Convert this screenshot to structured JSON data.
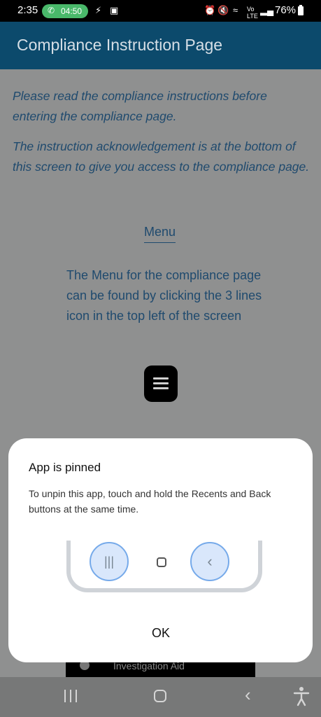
{
  "status_bar": {
    "time": "2:35",
    "call_timer": "04:50",
    "battery": "76%",
    "icons": [
      "messenger-icon",
      "gallery-icon",
      "alarm-icon",
      "mute-icon",
      "wifi-icon",
      "volte-icon",
      "signal-icon",
      "battery-icon"
    ]
  },
  "app_bar": {
    "title": "Compliance Instruction Page"
  },
  "content": {
    "intro_1": "Please read the compliance instructions before entering the compliance page.",
    "intro_2": "The instruction acknowledgement is at the bottom of this screen to give you access to the compliance page.",
    "menu_heading": "Menu",
    "menu_description": "The Menu for the compliance page can be found by clicking the 3 lines icon in the top left of the screen",
    "bottom_item_label": "Investigation Aid"
  },
  "dialog": {
    "title": "App is pinned",
    "message": "To unpin this app, touch and hold the Recents and Back buttons at the same time.",
    "ok_label": "OK"
  },
  "colors": {
    "app_bar": "#0c4a6c",
    "text_blue": "#1f4a6e",
    "dim_overlay": "#8f9090",
    "highlight_ring": "#76aaea"
  }
}
